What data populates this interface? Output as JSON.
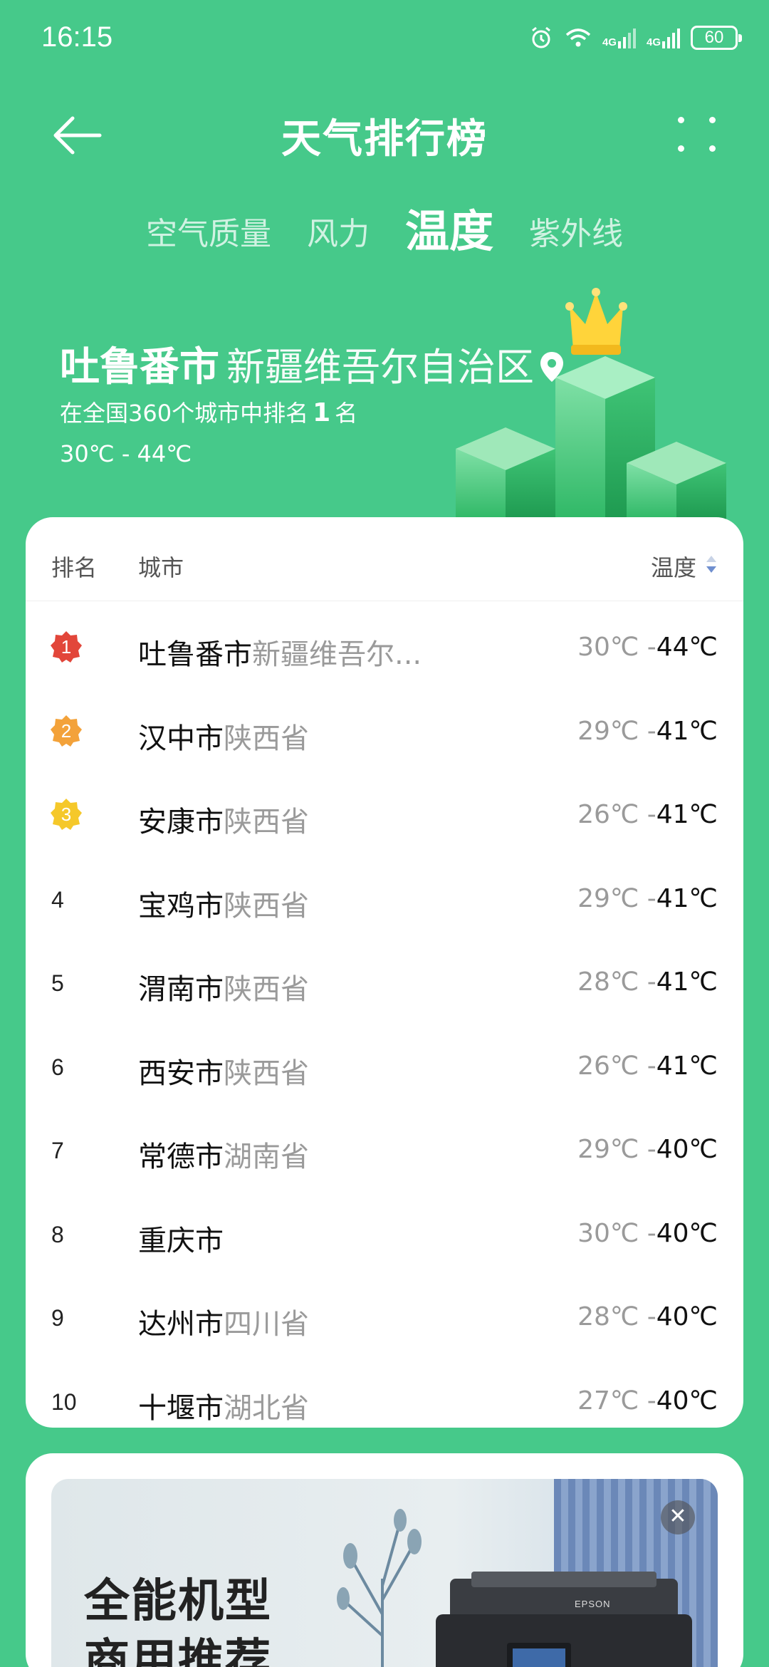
{
  "status_bar": {
    "time": "16:15",
    "network_1": "4G",
    "network_2": "4G",
    "battery": "60",
    "icons": [
      "alarm-icon",
      "wifi-icon",
      "signal-icon",
      "signal-icon",
      "battery-icon"
    ]
  },
  "header": {
    "title": "天气排行榜",
    "back_icon": "back-arrow-icon",
    "more_icon": "more-icon"
  },
  "tabs": [
    {
      "label": "空气质量",
      "active": false
    },
    {
      "label": "风力",
      "active": false
    },
    {
      "label": "温度",
      "active": true
    },
    {
      "label": "紫外线",
      "active": false
    }
  ],
  "hero": {
    "city": "吐鲁番市",
    "province": "新疆维吾尔自治区",
    "rank_prefix": "在全国360个城市中排名",
    "rank_number": "1",
    "rank_suffix": "名",
    "temperature": "30℃ - 44℃",
    "location_icon": "location-pin-icon",
    "crown_icon": "crown-icon"
  },
  "table": {
    "headers": {
      "rank": "排名",
      "city": "城市",
      "temp": "温度"
    },
    "sort_icon": "sort-icon",
    "rows": [
      {
        "rank": "1",
        "city": "吐鲁番市",
        "province": "新疆维吾尔...",
        "low": "30℃ -",
        "high": "44℃"
      },
      {
        "rank": "2",
        "city": "汉中市",
        "province": "陕西省",
        "low": "29℃ -",
        "high": "41℃"
      },
      {
        "rank": "3",
        "city": "安康市",
        "province": "陕西省",
        "low": "26℃ -",
        "high": "41℃"
      },
      {
        "rank": "4",
        "city": "宝鸡市",
        "province": "陕西省",
        "low": "29℃ -",
        "high": "41℃"
      },
      {
        "rank": "5",
        "city": "渭南市",
        "province": "陕西省",
        "low": "28℃ -",
        "high": "41℃"
      },
      {
        "rank": "6",
        "city": "西安市",
        "province": "陕西省",
        "low": "26℃ -",
        "high": "41℃"
      },
      {
        "rank": "7",
        "city": "常德市",
        "province": "湖南省",
        "low": "29℃ -",
        "high": "40℃"
      },
      {
        "rank": "8",
        "city": "重庆市",
        "province": "",
        "low": "30℃ -",
        "high": "40℃"
      },
      {
        "rank": "9",
        "city": "达州市",
        "province": "四川省",
        "low": "28℃ -",
        "high": "40℃"
      },
      {
        "rank": "10",
        "city": "十堰市",
        "province": "湖北省",
        "low": "27℃ -",
        "high": "40℃"
      }
    ]
  },
  "ad": {
    "headline": "全能机型",
    "subline": "商用推荐",
    "brand": "EPSON",
    "close": "✕",
    "close_icon": "close-icon"
  },
  "colors": {
    "background": "#46c98a",
    "badge_gold": "#e2463a",
    "badge_silver": "#f3a23a",
    "badge_bronze": "#f5c82a"
  }
}
